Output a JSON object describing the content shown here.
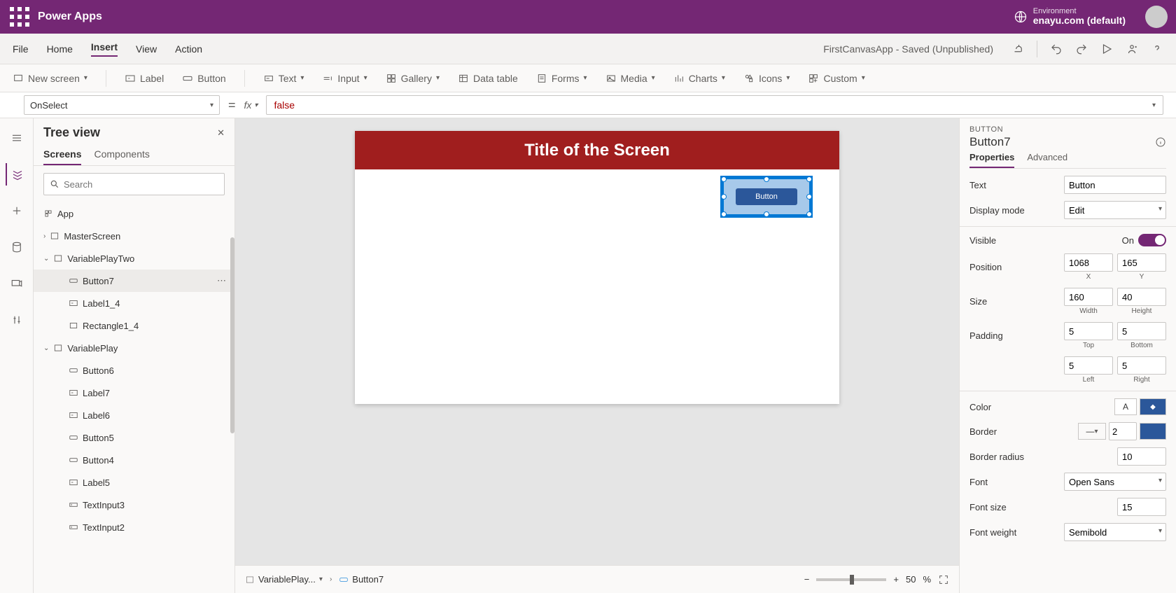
{
  "topbar": {
    "app": "Power Apps",
    "env_label": "Environment",
    "env_name": "enayu.com (default)"
  },
  "menu": {
    "items": [
      "File",
      "Home",
      "Insert",
      "View",
      "Action"
    ],
    "active": "Insert",
    "status": "FirstCanvasApp - Saved (Unpublished)"
  },
  "ribbon": {
    "newscreen": "New screen",
    "label": "Label",
    "button": "Button",
    "text": "Text",
    "input": "Input",
    "gallery": "Gallery",
    "datatable": "Data table",
    "forms": "Forms",
    "media": "Media",
    "charts": "Charts",
    "icons": "Icons",
    "custom": "Custom"
  },
  "fx": {
    "prop": "OnSelect",
    "value": "false"
  },
  "tree": {
    "title": "Tree view",
    "tabs": [
      "Screens",
      "Components"
    ],
    "search_ph": "Search",
    "nodes": {
      "app": "App",
      "master": "MasterScreen",
      "vptwo": "VariablePlayTwo",
      "button7": "Button7",
      "label1_4": "Label1_4",
      "rect1_4": "Rectangle1_4",
      "vp": "VariablePlay",
      "button6": "Button6",
      "label7": "Label7",
      "label6": "Label6",
      "button5": "Button5",
      "button4": "Button4",
      "label5": "Label5",
      "ti3": "TextInput3",
      "ti2": "TextInput2"
    }
  },
  "canvas": {
    "title": "Title of the Screen",
    "btn_text": "Button",
    "crumb1": "VariablePlay...",
    "crumb2": "Button7",
    "zoom": "50",
    "zoom_pct": "%"
  },
  "props": {
    "type": "BUTTON",
    "name": "Button7",
    "tabs": [
      "Properties",
      "Advanced"
    ],
    "text_lbl": "Text",
    "text_val": "Button",
    "disp_lbl": "Display mode",
    "disp_val": "Edit",
    "vis_lbl": "Visible",
    "vis_on": "On",
    "pos_lbl": "Position",
    "pos_x": "1068",
    "pos_y": "165",
    "x": "X",
    "y": "Y",
    "size_lbl": "Size",
    "size_w": "160",
    "size_h": "40",
    "w": "Width",
    "h": "Height",
    "pad_lbl": "Padding",
    "pad_t": "5",
    "pad_b": "5",
    "pad_l": "5",
    "pad_r": "5",
    "top": "Top",
    "bottom": "Bottom",
    "left": "Left",
    "right": "Right",
    "color_lbl": "Color",
    "border_lbl": "Border",
    "border_w": "2",
    "radius_lbl": "Border radius",
    "radius_val": "10",
    "font_lbl": "Font",
    "font_val": "Open Sans",
    "fsize_lbl": "Font size",
    "fsize_val": "15",
    "fweight_lbl": "Font weight",
    "fweight_val": "Semibold"
  }
}
